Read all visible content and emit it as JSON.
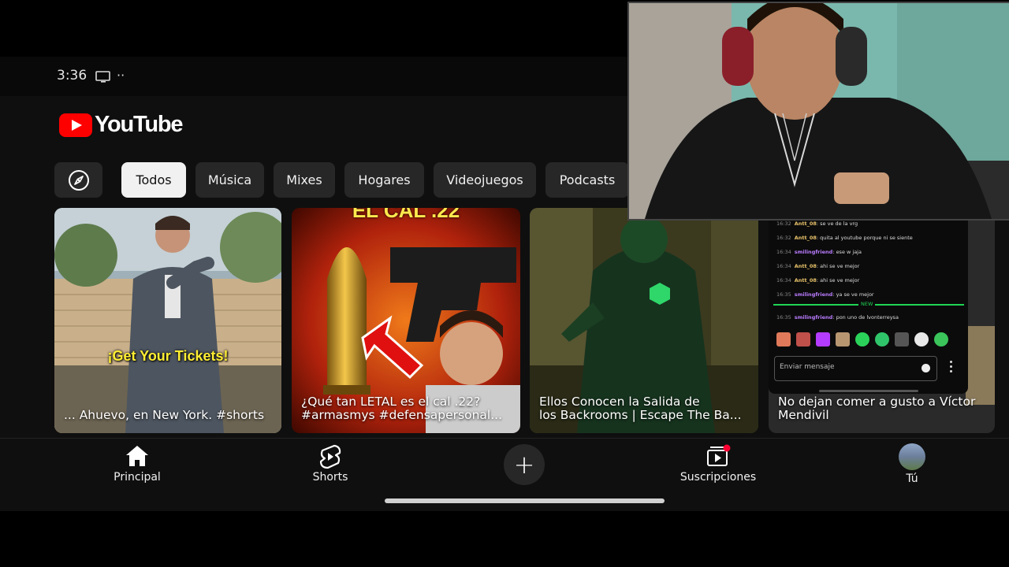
{
  "status_bar": {
    "time": "3:36",
    "dots": "··"
  },
  "logo": {
    "text": "YouTube"
  },
  "chips": [
    "Todos",
    "Música",
    "Mixes",
    "Hogares",
    "Videojuegos",
    "Podcasts"
  ],
  "videos": [
    {
      "title": "... Ahuevo, en New York. #shorts",
      "overlay": "¡Get Your Tickets!"
    },
    {
      "title": "¿Qué tan LETAL es el cal .22?\n#armasmys  #defensapersonal...",
      "overlay": "EL CAL .22"
    },
    {
      "title": "Ellos Conocen la Salida de\nlos Backrooms | Escape The Ba...",
      "overlay": ""
    },
    {
      "title": "No dejan comer a gusto a Víctor\nMendivil",
      "overlay": ""
    }
  ],
  "nav": {
    "home": "Principal",
    "shorts": "Shorts",
    "create": "+",
    "subs": "Suscripciones",
    "you": "Tú"
  },
  "chat": {
    "messages": [
      {
        "time": "16:32",
        "user": "Antt_08",
        "text": "se ve de la vrg"
      },
      {
        "time": "16:32",
        "user": "Antt_08",
        "text": "quita al youtube porque ni se siente"
      },
      {
        "time": "16:34",
        "user": "smilingfriend",
        "text": "ese w jaja"
      },
      {
        "time": "16:34",
        "user": "Antt_08",
        "text": "ahi se ve mejor"
      },
      {
        "time": "16:34",
        "user": "Antt_08",
        "text": "ahi se ve mejor"
      },
      {
        "time": "16:35",
        "user": "smilingfriend",
        "text": "ya se ve mejor"
      },
      {
        "time": "16:35",
        "user": "smilingfriend",
        "text": "pon uno de lvonterreysa"
      }
    ],
    "new_label": "NEW",
    "input_placeholder": "Enviar mensaje"
  },
  "colors": {
    "accent": "#ff0000",
    "chip_bg": "#272727",
    "chip_active_bg": "#f1f1f1",
    "chat_user_1": "#e8c36a",
    "chat_user_2": "#b97cff",
    "new_separator": "#1fd655"
  }
}
